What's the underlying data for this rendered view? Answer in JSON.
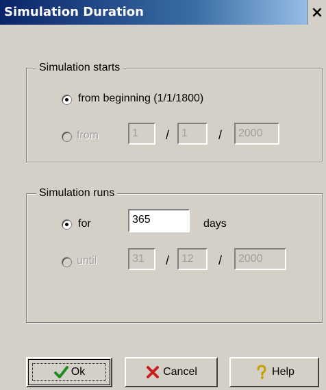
{
  "window": {
    "title": "Simulation Duration",
    "close_label": "×"
  },
  "starts": {
    "legend": "Simulation starts",
    "option_beginning": {
      "label": "from beginning (1/1/1800)",
      "checked": true
    },
    "option_from": {
      "label": "from",
      "checked": false,
      "day": "1",
      "month": "1",
      "year": "2000"
    }
  },
  "runs": {
    "legend": "Simulation runs",
    "option_for": {
      "label": "for",
      "checked": true,
      "value": "365",
      "unit": "days"
    },
    "option_until": {
      "label": "until",
      "checked": false,
      "day": "31",
      "month": "12",
      "year": "2000"
    }
  },
  "separator": "/",
  "buttons": {
    "ok": "Ok",
    "cancel": "Cancel",
    "help": "Help"
  },
  "icons": {
    "ok": "check-icon",
    "cancel": "x-icon",
    "help": "question-icon",
    "ok_color": "#1e8c1e",
    "cancel_color": "#c81e1e",
    "help_color": "#c8a000"
  }
}
